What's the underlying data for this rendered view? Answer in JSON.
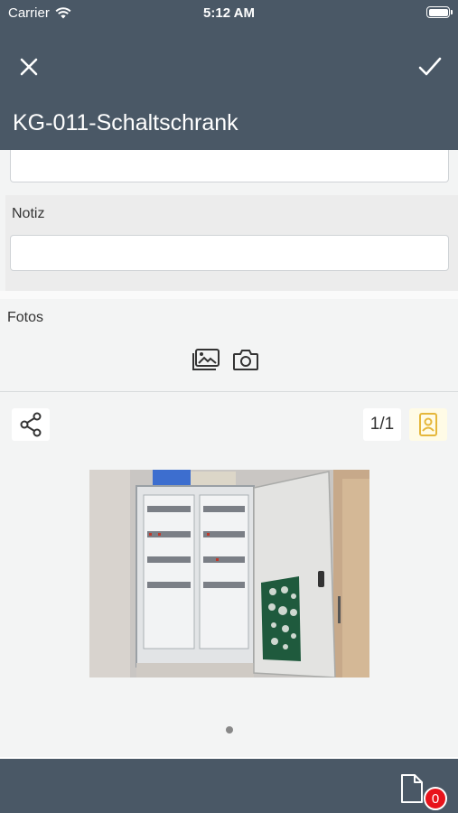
{
  "status_bar": {
    "carrier": "Carrier",
    "time": "5:12 AM",
    "wifi_icon": "wifi-icon",
    "battery_icon": "battery-icon"
  },
  "nav": {
    "close_icon": "close-icon",
    "confirm_icon": "checkmark-icon",
    "title": "KG-011-Schaltschrank"
  },
  "form": {
    "top_field_value": "",
    "notiz": {
      "label": "Notiz",
      "value": ""
    }
  },
  "fotos": {
    "label": "Fotos",
    "gallery_icon": "image-gallery-icon",
    "camera_icon": "camera-icon"
  },
  "gallery": {
    "share_icon": "share-icon",
    "counter": "1/1",
    "contact_icon": "contact-card-icon",
    "photo": "electrical-cabinet-photo",
    "page_indicator_count": 1,
    "page_indicator_active": 0
  },
  "bottom_bar": {
    "document_icon": "document-icon",
    "badge_count": "0"
  },
  "colors": {
    "nav_background": "#4a5866",
    "content_background": "#f3f4f4",
    "badge_red": "#e8131b",
    "contact_highlight": "#f2c94c"
  }
}
